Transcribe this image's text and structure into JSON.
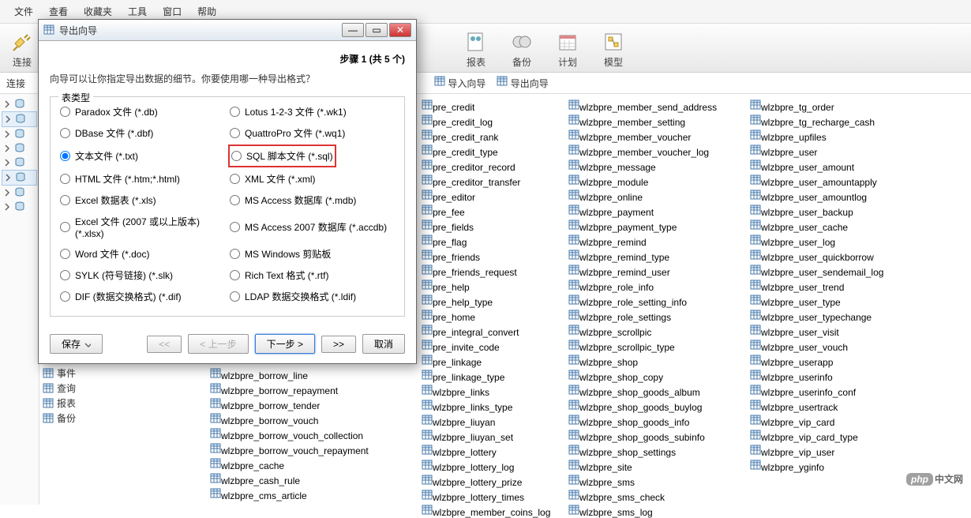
{
  "menu": [
    "文件",
    "查看",
    "收藏夹",
    "工具",
    "窗口",
    "帮助"
  ],
  "toolbar": {
    "items": [
      {
        "label": "连接",
        "icon": "plug"
      },
      {
        "label": "报表",
        "icon": "report"
      },
      {
        "label": "备份",
        "icon": "backup"
      },
      {
        "label": "计划",
        "icon": "schedule"
      },
      {
        "label": "模型",
        "icon": "model"
      }
    ]
  },
  "breadcrumb": {
    "title": "连接",
    "import": "导入向导",
    "export": "导出向导"
  },
  "sidebar_expanders": 8,
  "tree2": [
    {
      "label": "事件",
      "icon": "event"
    },
    {
      "label": "查询",
      "icon": "query"
    },
    {
      "label": "报表",
      "icon": "report2"
    },
    {
      "label": "备份",
      "icon": "backup2"
    }
  ],
  "dialog": {
    "title": "导出向导",
    "step": "步骤 1 (共 5 个)",
    "instr": "向导可以让你指定导出数据的细节。你要使用哪一种导出格式？",
    "legend": "表类型",
    "radios_left": [
      "Paradox 文件 (*.db)",
      "DBase 文件 (*.dbf)",
      "文本文件 (*.txt)",
      "HTML 文件 (*.htm;*.html)",
      "Excel 数据表 (*.xls)",
      "Excel 文件 (2007 或以上版本) (*.xlsx)",
      "Word 文件 (*.doc)",
      "SYLK (符号链接) (*.slk)",
      "DIF (数据交换格式) (*.dif)"
    ],
    "radios_right": [
      "Lotus 1-2-3 文件 (*.wk1)",
      "QuattroPro 文件 (*.wq1)",
      "SQL 脚本文件 (*.sql)",
      "XML 文件 (*.xml)",
      "MS Access 数据库 (*.mdb)",
      "MS Access 2007 数据库 (*.accdb)",
      "MS Windows 剪贴板",
      "Rich Text 格式 (*.rtf)",
      "LDAP 数据交换格式 (*.ldif)"
    ],
    "selected_left_index": 2,
    "highlight_right_index": 2,
    "buttons": {
      "save": "保存",
      "first": "<<",
      "prev": "< 上一步",
      "next": "下一步 >",
      "last": ">>",
      "cancel": "取消"
    }
  },
  "tables_col1": [
    "wlzbpre_borrow_line",
    "wlzbpre_borrow_repayment",
    "wlzbpre_borrow_tender",
    "wlzbpre_borrow_vouch",
    "wlzbpre_borrow_vouch_collection",
    "wlzbpre_borrow_vouch_repayment",
    "wlzbpre_cache",
    "wlzbpre_cash_rule",
    "wlzbpre_cms_article"
  ],
  "tables_col2": [
    "pre_credit",
    "pre_credit_log",
    "pre_credit_rank",
    "pre_credit_type",
    "pre_creditor_record",
    "pre_creditor_transfer",
    "pre_editor",
    "pre_fee",
    "pre_fields",
    "pre_flag",
    "pre_friends",
    "pre_friends_request",
    "pre_help",
    "pre_help_type",
    "pre_home",
    "pre_integral_convert",
    "pre_invite_code",
    "pre_linkage",
    "pre_linkage_type",
    "wlzbpre_links",
    "wlzbpre_links_type",
    "wlzbpre_liuyan",
    "wlzbpre_liuyan_set",
    "wlzbpre_lottery",
    "wlzbpre_lottery_log",
    "wlzbpre_lottery_prize",
    "wlzbpre_lottery_times",
    "wlzbpre_member_coins_log"
  ],
  "tables_col3": [
    "wlzbpre_member_send_address",
    "wlzbpre_member_setting",
    "wlzbpre_member_voucher",
    "wlzbpre_member_voucher_log",
    "wlzbpre_message",
    "wlzbpre_module",
    "wlzbpre_online",
    "wlzbpre_payment",
    "wlzbpre_payment_type",
    "wlzbpre_remind",
    "wlzbpre_remind_type",
    "wlzbpre_remind_user",
    "wlzbpre_role_info",
    "wlzbpre_role_setting_info",
    "wlzbpre_role_settings",
    "wlzbpre_scrollpic",
    "wlzbpre_scrollpic_type",
    "wlzbpre_shop",
    "wlzbpre_shop_copy",
    "wlzbpre_shop_goods_album",
    "wlzbpre_shop_goods_buylog",
    "wlzbpre_shop_goods_info",
    "wlzbpre_shop_goods_subinfo",
    "wlzbpre_shop_settings",
    "wlzbpre_site",
    "wlzbpre_sms",
    "wlzbpre_sms_check",
    "wlzbpre_sms_log"
  ],
  "tables_col4": [
    "wlzbpre_tg_order",
    "wlzbpre_tg_recharge_cash",
    "wlzbpre_upfiles",
    "wlzbpre_user",
    "wlzbpre_user_amount",
    "wlzbpre_user_amountapply",
    "wlzbpre_user_amountlog",
    "wlzbpre_user_backup",
    "wlzbpre_user_cache",
    "wlzbpre_user_log",
    "wlzbpre_user_quickborrow",
    "wlzbpre_user_sendemail_log",
    "wlzbpre_user_trend",
    "wlzbpre_user_type",
    "wlzbpre_user_typechange",
    "wlzbpre_user_visit",
    "wlzbpre_user_vouch",
    "wlzbpre_userapp",
    "wlzbpre_userinfo",
    "wlzbpre_userinfo_conf",
    "wlzbpre_usertrack",
    "wlzbpre_vip_card",
    "wlzbpre_vip_card_type",
    "wlzbpre_vip_user",
    "wlzbpre_yginfo"
  ],
  "watermark": "中文网"
}
